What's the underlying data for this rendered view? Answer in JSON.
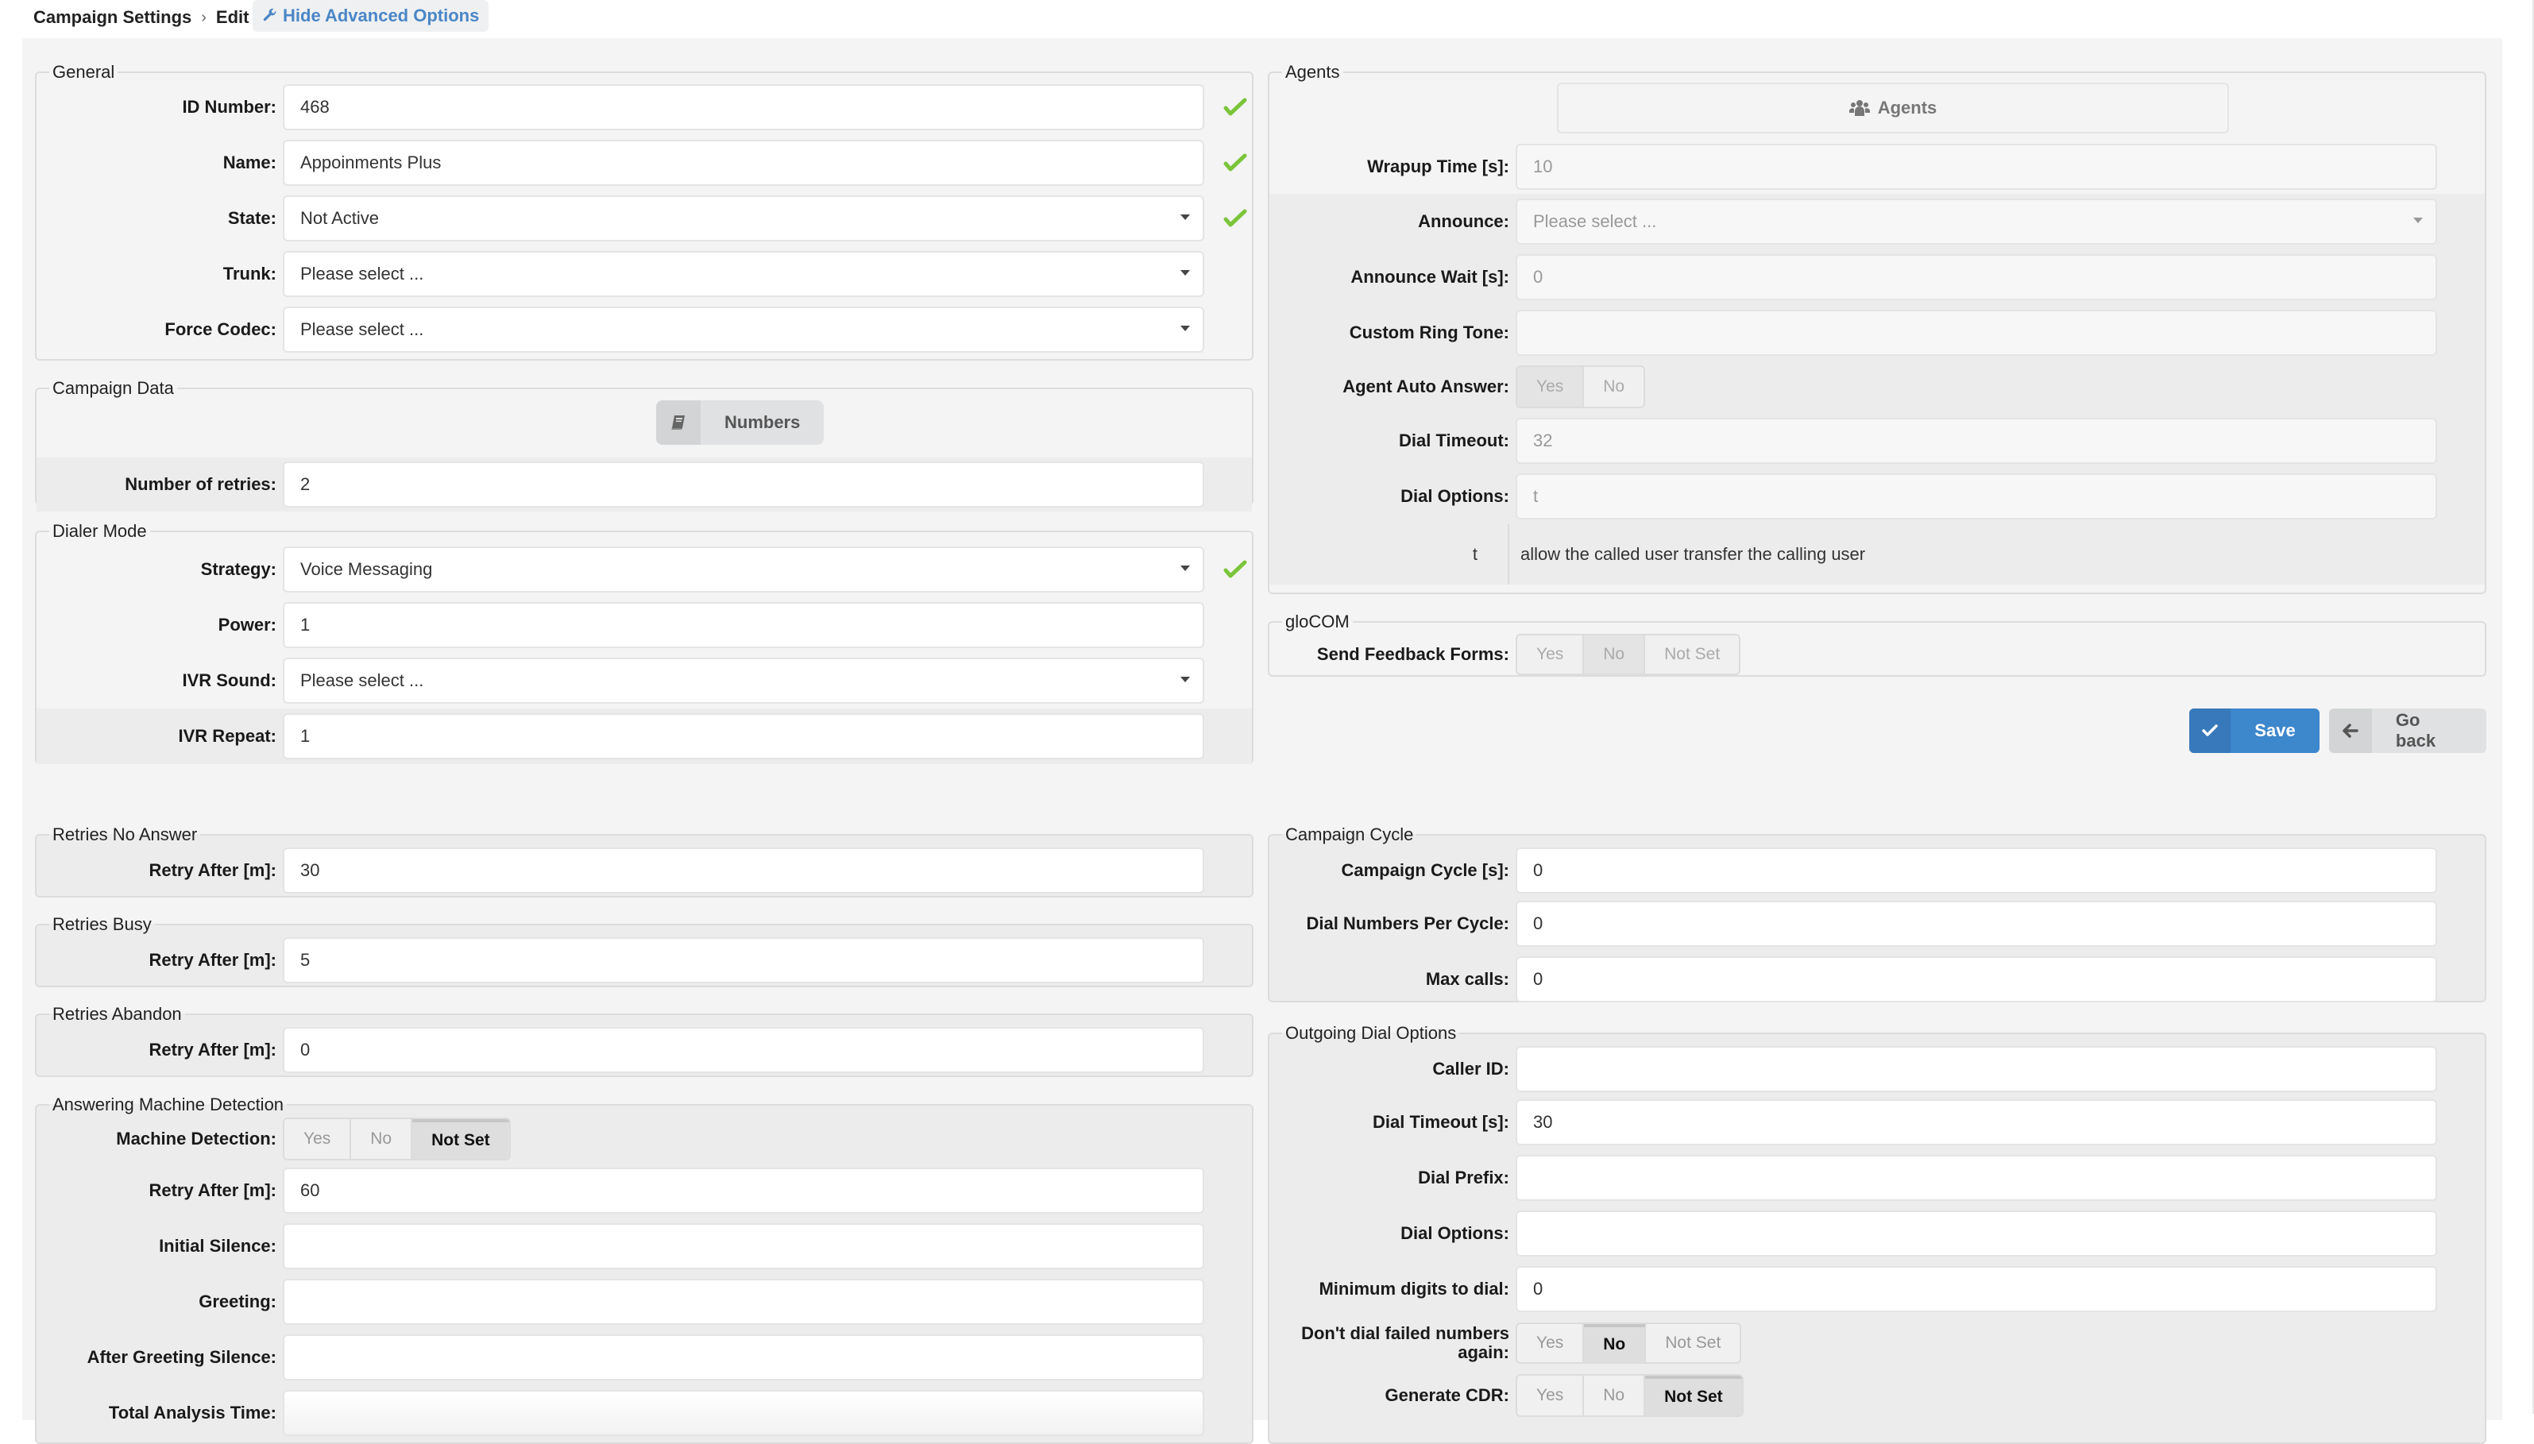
{
  "header": {
    "breadcrumb": [
      "Campaign Settings",
      "Edit"
    ],
    "separator": "›",
    "advanced_toggle": "Hide Advanced Options",
    "advanced_icon": "wrench-icon"
  },
  "general": {
    "title": "General",
    "fields": {
      "id_number": {
        "label": "ID Number:",
        "value": "468",
        "valid": true
      },
      "name": {
        "label": "Name:",
        "value": "Appoinments Plus",
        "valid": true
      },
      "state": {
        "label": "State:",
        "value": "Not Active",
        "valid": true
      },
      "trunk": {
        "label": "Trunk:",
        "value": "Please select ..."
      },
      "force_codec": {
        "label": "Force Codec:",
        "value": "Please select ..."
      }
    }
  },
  "campaign_data": {
    "title": "Campaign Data",
    "numbers_button": "Numbers",
    "numbers_icon": "book-icon",
    "number_of_retries": {
      "label": "Number of retries:",
      "value": "2"
    }
  },
  "dialer_mode": {
    "title": "Dialer Mode",
    "strategy": {
      "label": "Strategy:",
      "value": "Voice Messaging",
      "valid": true
    },
    "power": {
      "label": "Power:",
      "value": "1"
    },
    "ivr_sound": {
      "label": "IVR Sound:",
      "value": "Please select ..."
    },
    "ivr_repeat": {
      "label": "IVR Repeat:",
      "value": "1"
    }
  },
  "retries_no_answer": {
    "title": "Retries No Answer",
    "label": "Retry After [m]:",
    "value": "30"
  },
  "retries_busy": {
    "title": "Retries Busy",
    "label": "Retry After [m]:",
    "value": "5"
  },
  "retries_abandon": {
    "title": "Retries Abandon",
    "label": "Retry After [m]:",
    "value": "0"
  },
  "amd": {
    "title": "Answering Machine Detection",
    "machine_detection": {
      "label": "Machine Detection:",
      "options": [
        "Yes",
        "No",
        "Not Set"
      ],
      "selected": "Not Set"
    },
    "retry_after": {
      "label": "Retry After [m]:",
      "value": "60"
    },
    "initial_silence": {
      "label": "Initial Silence:",
      "value": ""
    },
    "greeting": {
      "label": "Greeting:",
      "value": ""
    },
    "after_greeting_silence": {
      "label": "After Greeting Silence:",
      "value": ""
    },
    "total_analysis_time": {
      "label": "Total Analysis Time:",
      "value": ""
    }
  },
  "agents": {
    "title": "Agents",
    "agents_button": "Agents",
    "agents_icon": "users-icon",
    "wrapup_time": {
      "label": "Wrapup Time [s]:",
      "value": "10"
    },
    "announce": {
      "label": "Announce:",
      "value": "Please select ..."
    },
    "announce_wait": {
      "label": "Announce Wait [s]:",
      "value": "0"
    },
    "custom_ring_tone": {
      "label": "Custom Ring Tone:",
      "value": ""
    },
    "agent_auto_answer": {
      "label": "Agent Auto Answer:",
      "options": [
        "Yes",
        "No"
      ],
      "selected": "Yes"
    },
    "dial_timeout": {
      "label": "Dial Timeout:",
      "value": "32"
    },
    "dial_options": {
      "label": "Dial Options:",
      "value": "t"
    },
    "dial_options_hint": {
      "key": "t",
      "description": "allow the called user transfer the calling user"
    }
  },
  "glocom": {
    "title": "gloCOM",
    "send_feedback_forms": {
      "label": "Send Feedback Forms:",
      "options": [
        "Yes",
        "No",
        "Not Set"
      ],
      "selected": "No"
    }
  },
  "actions": {
    "save": "Save",
    "go_back": "Go back",
    "save_icon": "check-icon",
    "back_icon": "arrow-left-icon"
  },
  "campaign_cycle": {
    "title": "Campaign Cycle",
    "campaign_cycle": {
      "label": "Campaign Cycle [s]:",
      "value": "0"
    },
    "dial_numbers_per_cycle": {
      "label": "Dial Numbers Per Cycle:",
      "value": "0"
    },
    "max_calls": {
      "label": "Max calls:",
      "value": "0"
    }
  },
  "outgoing_dial_options": {
    "title": "Outgoing Dial Options",
    "caller_id": {
      "label": "Caller ID:",
      "value": ""
    },
    "dial_timeout": {
      "label": "Dial Timeout [s]:",
      "value": "30"
    },
    "dial_prefix": {
      "label": "Dial Prefix:",
      "value": ""
    },
    "dial_options": {
      "label": "Dial Options:",
      "value": ""
    },
    "minimum_digits": {
      "label": "Minimum digits to dial:",
      "value": "0"
    },
    "dont_dial_failed": {
      "label": "Don't dial failed numbers again:",
      "options": [
        "Yes",
        "No",
        "Not Set"
      ],
      "selected": "No"
    },
    "generate_cdr": {
      "label": "Generate CDR:",
      "options": [
        "Yes",
        "No",
        "Not Set"
      ],
      "selected": "Not Set"
    }
  },
  "colors": {
    "accent": "#3d87cc",
    "valid": "#7cc53a",
    "link": "#4a86c5",
    "panel": "#f4f4f4"
  }
}
